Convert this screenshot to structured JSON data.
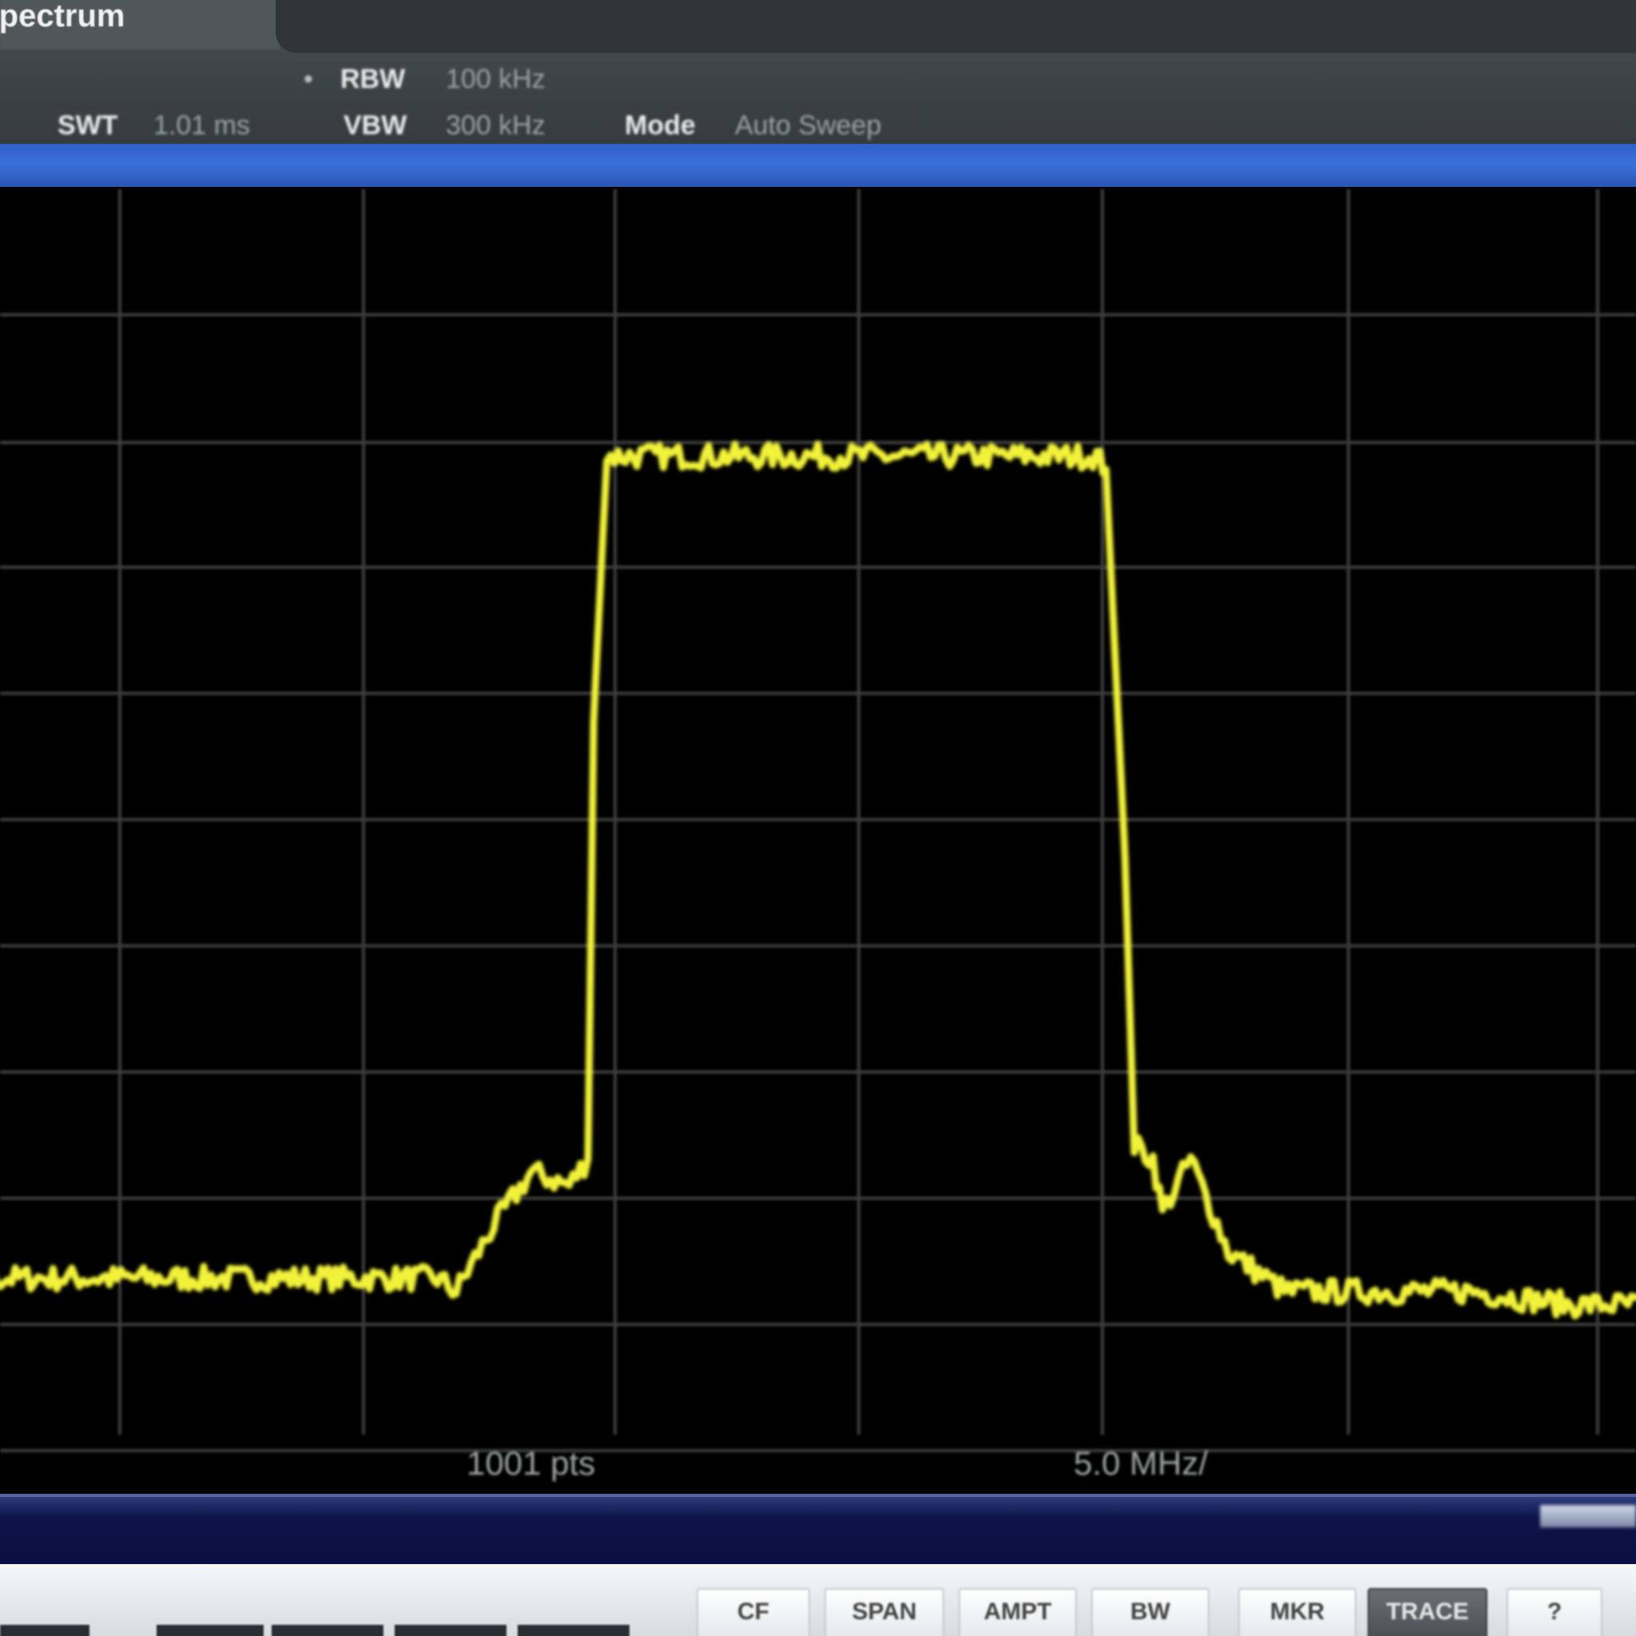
{
  "app": {
    "title": "Spectrum"
  },
  "header": {
    "params_row1": [
      {
        "mark": "•",
        "key": "RBW",
        "value": "100 kHz"
      }
    ],
    "params_row2": [
      {
        "key": "SWT",
        "value": "1.01 ms"
      },
      {
        "key": "VBW",
        "value": "300 kHz"
      },
      {
        "key": "Mode",
        "value": "Auto Sweep"
      }
    ]
  },
  "plot": {
    "x_label_left": "1001 pts",
    "x_label_right": "5.0 MHz/",
    "trace_color": "#f2f23a",
    "grid_color": "#3c3c3c"
  },
  "softkeys": [
    {
      "label": "CF"
    },
    {
      "label": "SPAN"
    },
    {
      "label": "AMPT"
    },
    {
      "label": "BW"
    },
    {
      "label": "MKR"
    },
    {
      "label": "TRACE"
    },
    {
      "label": "?"
    }
  ],
  "colors": {
    "header_bg": "#3c4345",
    "channel_bar": "#3c70da",
    "status_bar": "#0c1448",
    "softkey_bar": "#e8eaee"
  },
  "chart_data": {
    "type": "line",
    "title": "",
    "xlabel": "",
    "ylabel": "",
    "x": [
      0.0,
      0.05,
      0.1,
      0.15,
      0.2,
      0.25,
      0.3,
      0.31,
      0.33,
      0.35,
      0.37,
      0.38,
      0.383,
      0.39,
      0.4,
      0.45,
      0.5,
      0.55,
      0.6,
      0.65,
      0.655,
      0.665,
      0.67,
      0.68,
      0.685,
      0.7,
      0.72,
      0.75,
      0.8,
      0.85,
      0.9,
      0.95,
      1.0
    ],
    "y": [
      0.13,
      0.13,
      0.13,
      0.13,
      0.13,
      0.13,
      0.13,
      0.12,
      0.17,
      0.21,
      0.2,
      0.22,
      0.55,
      0.75,
      0.75,
      0.75,
      0.75,
      0.75,
      0.75,
      0.75,
      0.74,
      0.45,
      0.23,
      0.22,
      0.18,
      0.22,
      0.15,
      0.12,
      0.12,
      0.12,
      0.11,
      0.11,
      0.11
    ],
    "xlim": [
      0,
      1
    ],
    "ylim": [
      0,
      1
    ],
    "grid": true,
    "legend": "none"
  }
}
